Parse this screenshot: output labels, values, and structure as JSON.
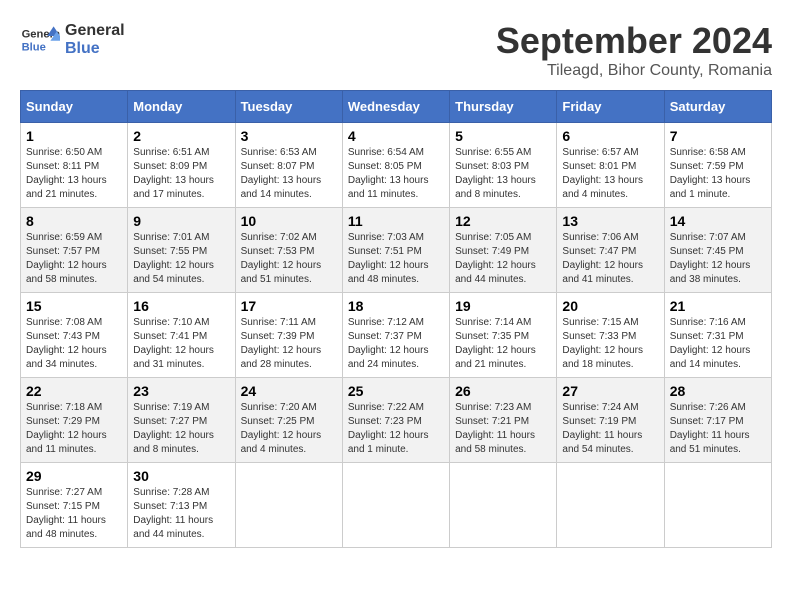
{
  "logo": {
    "line1": "General",
    "line2": "Blue"
  },
  "title": "September 2024",
  "location": "Tileagd, Bihor County, Romania",
  "weekdays": [
    "Sunday",
    "Monday",
    "Tuesday",
    "Wednesday",
    "Thursday",
    "Friday",
    "Saturday"
  ],
  "weeks": [
    [
      {
        "day": "1",
        "sunrise": "6:50 AM",
        "sunset": "8:11 PM",
        "daylight": "13 hours and 21 minutes"
      },
      {
        "day": "2",
        "sunrise": "6:51 AM",
        "sunset": "8:09 PM",
        "daylight": "13 hours and 17 minutes"
      },
      {
        "day": "3",
        "sunrise": "6:53 AM",
        "sunset": "8:07 PM",
        "daylight": "13 hours and 14 minutes"
      },
      {
        "day": "4",
        "sunrise": "6:54 AM",
        "sunset": "8:05 PM",
        "daylight": "13 hours and 11 minutes"
      },
      {
        "day": "5",
        "sunrise": "6:55 AM",
        "sunset": "8:03 PM",
        "daylight": "13 hours and 8 minutes"
      },
      {
        "day": "6",
        "sunrise": "6:57 AM",
        "sunset": "8:01 PM",
        "daylight": "13 hours and 4 minutes"
      },
      {
        "day": "7",
        "sunrise": "6:58 AM",
        "sunset": "7:59 PM",
        "daylight": "13 hours and 1 minute"
      }
    ],
    [
      {
        "day": "8",
        "sunrise": "6:59 AM",
        "sunset": "7:57 PM",
        "daylight": "12 hours and 58 minutes"
      },
      {
        "day": "9",
        "sunrise": "7:01 AM",
        "sunset": "7:55 PM",
        "daylight": "12 hours and 54 minutes"
      },
      {
        "day": "10",
        "sunrise": "7:02 AM",
        "sunset": "7:53 PM",
        "daylight": "12 hours and 51 minutes"
      },
      {
        "day": "11",
        "sunrise": "7:03 AM",
        "sunset": "7:51 PM",
        "daylight": "12 hours and 48 minutes"
      },
      {
        "day": "12",
        "sunrise": "7:05 AM",
        "sunset": "7:49 PM",
        "daylight": "12 hours and 44 minutes"
      },
      {
        "day": "13",
        "sunrise": "7:06 AM",
        "sunset": "7:47 PM",
        "daylight": "12 hours and 41 minutes"
      },
      {
        "day": "14",
        "sunrise": "7:07 AM",
        "sunset": "7:45 PM",
        "daylight": "12 hours and 38 minutes"
      }
    ],
    [
      {
        "day": "15",
        "sunrise": "7:08 AM",
        "sunset": "7:43 PM",
        "daylight": "12 hours and 34 minutes"
      },
      {
        "day": "16",
        "sunrise": "7:10 AM",
        "sunset": "7:41 PM",
        "daylight": "12 hours and 31 minutes"
      },
      {
        "day": "17",
        "sunrise": "7:11 AM",
        "sunset": "7:39 PM",
        "daylight": "12 hours and 28 minutes"
      },
      {
        "day": "18",
        "sunrise": "7:12 AM",
        "sunset": "7:37 PM",
        "daylight": "12 hours and 24 minutes"
      },
      {
        "day": "19",
        "sunrise": "7:14 AM",
        "sunset": "7:35 PM",
        "daylight": "12 hours and 21 minutes"
      },
      {
        "day": "20",
        "sunrise": "7:15 AM",
        "sunset": "7:33 PM",
        "daylight": "12 hours and 18 minutes"
      },
      {
        "day": "21",
        "sunrise": "7:16 AM",
        "sunset": "7:31 PM",
        "daylight": "12 hours and 14 minutes"
      }
    ],
    [
      {
        "day": "22",
        "sunrise": "7:18 AM",
        "sunset": "7:29 PM",
        "daylight": "12 hours and 11 minutes"
      },
      {
        "day": "23",
        "sunrise": "7:19 AM",
        "sunset": "7:27 PM",
        "daylight": "12 hours and 8 minutes"
      },
      {
        "day": "24",
        "sunrise": "7:20 AM",
        "sunset": "7:25 PM",
        "daylight": "12 hours and 4 minutes"
      },
      {
        "day": "25",
        "sunrise": "7:22 AM",
        "sunset": "7:23 PM",
        "daylight": "12 hours and 1 minute"
      },
      {
        "day": "26",
        "sunrise": "7:23 AM",
        "sunset": "7:21 PM",
        "daylight": "11 hours and 58 minutes"
      },
      {
        "day": "27",
        "sunrise": "7:24 AM",
        "sunset": "7:19 PM",
        "daylight": "11 hours and 54 minutes"
      },
      {
        "day": "28",
        "sunrise": "7:26 AM",
        "sunset": "7:17 PM",
        "daylight": "11 hours and 51 minutes"
      }
    ],
    [
      {
        "day": "29",
        "sunrise": "7:27 AM",
        "sunset": "7:15 PM",
        "daylight": "11 hours and 48 minutes"
      },
      {
        "day": "30",
        "sunrise": "7:28 AM",
        "sunset": "7:13 PM",
        "daylight": "11 hours and 44 minutes"
      },
      null,
      null,
      null,
      null,
      null
    ]
  ]
}
